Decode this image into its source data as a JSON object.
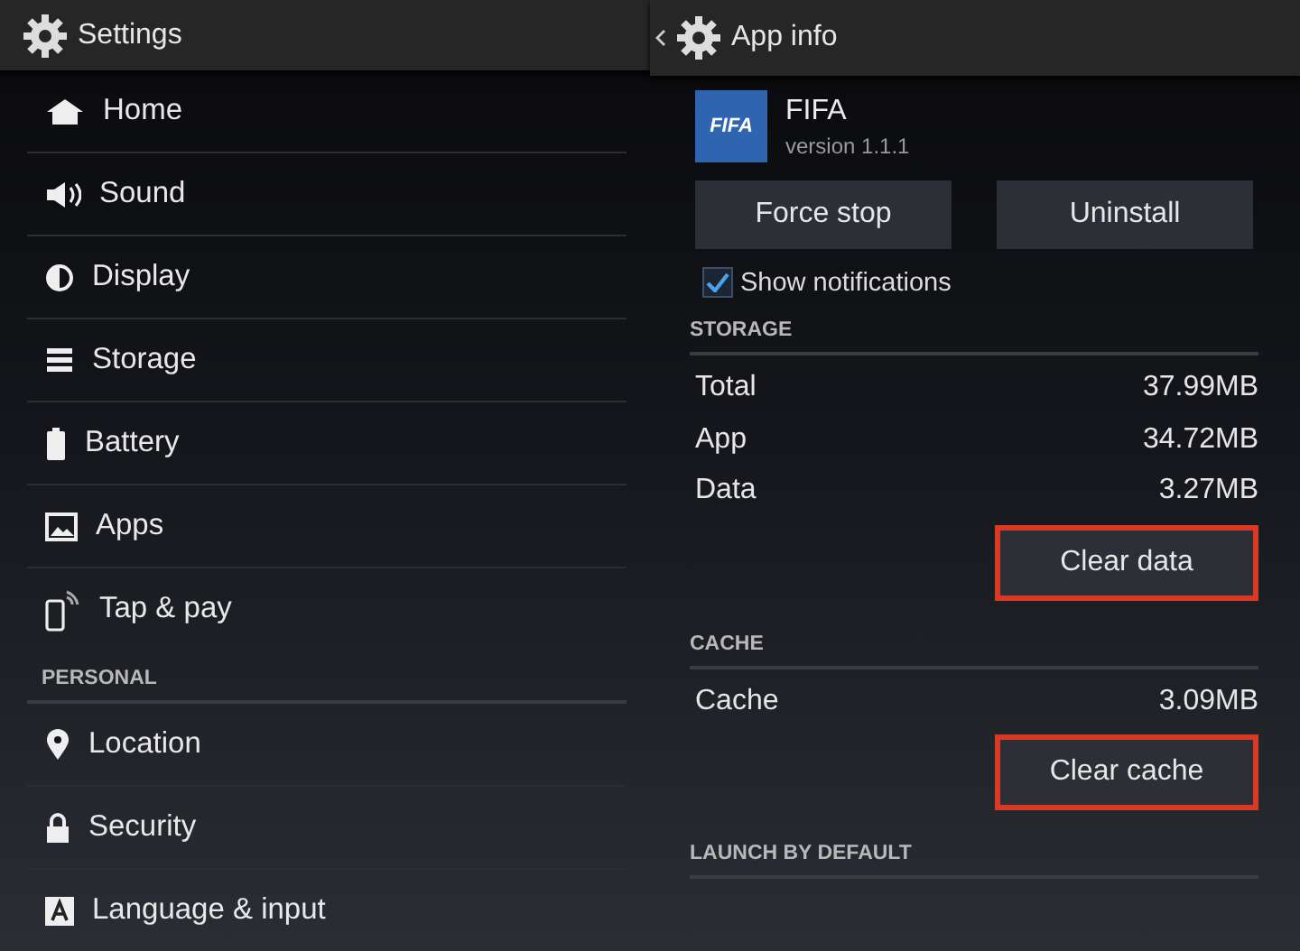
{
  "left_bar": {
    "title": "Settings"
  },
  "settings_items": [
    {
      "kind": "item",
      "label": "Home"
    },
    {
      "kind": "item",
      "label": "Sound"
    },
    {
      "kind": "item",
      "label": "Display"
    },
    {
      "kind": "item",
      "label": "Storage"
    },
    {
      "kind": "item",
      "label": "Battery"
    },
    {
      "kind": "item",
      "label": "Apps"
    },
    {
      "kind": "item",
      "label": "Tap & pay"
    },
    {
      "kind": "header",
      "label": "PERSONAL"
    },
    {
      "kind": "item",
      "label": "Location"
    },
    {
      "kind": "item",
      "label": "Security"
    },
    {
      "kind": "item",
      "label": "Language & input"
    }
  ],
  "right_bar": {
    "title": "App info"
  },
  "app": {
    "icon_text": "FIFA",
    "name": "FIFA",
    "version": "version 1.1.1"
  },
  "action_buttons": [
    {
      "label": "Force stop"
    },
    {
      "label": "Uninstall"
    }
  ],
  "notifications": {
    "label": "Show notifications",
    "checked": true
  },
  "sections": [
    {
      "header": "STORAGE",
      "rows": [
        {
          "label": "Total",
          "value": "37.99MB"
        },
        {
          "label": "App",
          "value": "34.72MB"
        },
        {
          "label": "Data",
          "value": "3.27MB"
        }
      ],
      "button": {
        "label": "Clear data",
        "highlighted": true
      }
    },
    {
      "header": "CACHE",
      "rows": [
        {
          "label": "Cache",
          "value": "3.09MB"
        }
      ],
      "button": {
        "label": "Clear cache",
        "highlighted": true
      }
    },
    {
      "header": "LAUNCH BY DEFAULT"
    }
  ]
}
